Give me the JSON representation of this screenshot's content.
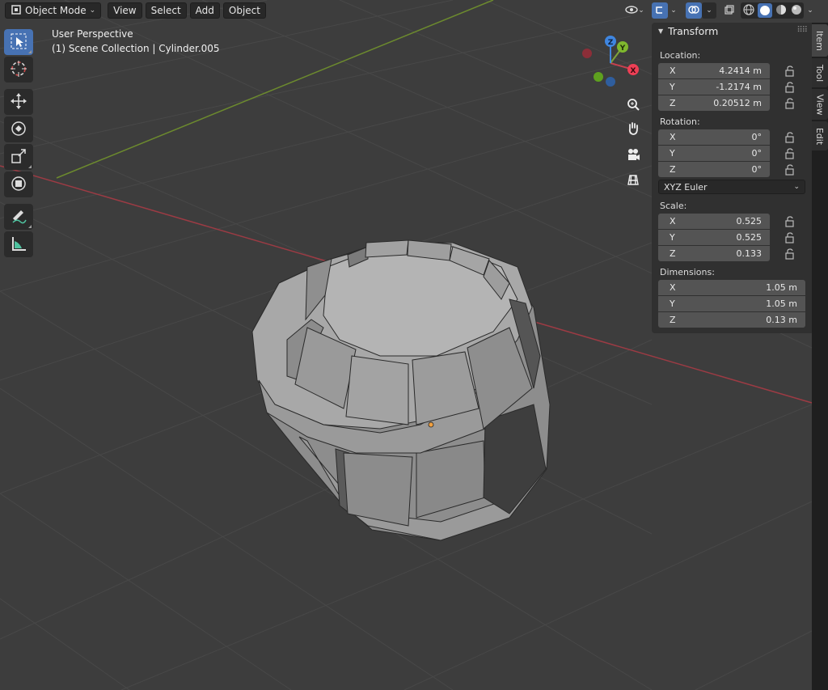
{
  "header": {
    "mode_label": "Object Mode",
    "menus": [
      "View",
      "Select",
      "Add",
      "Object"
    ]
  },
  "viewport": {
    "perspective_label": "User Perspective",
    "collection_label": "(1) Scene Collection | Cylinder.005"
  },
  "gizmo": {
    "x_label": "X",
    "y_label": "Y",
    "z_label": "Z"
  },
  "sidebar_tabs": [
    "Item",
    "Tool",
    "View",
    "Edit"
  ],
  "transform": {
    "title": "Transform",
    "location_label": "Location:",
    "location": [
      {
        "axis": "X",
        "value": "4.2414 m"
      },
      {
        "axis": "Y",
        "value": "-1.2174 m"
      },
      {
        "axis": "Z",
        "value": "0.20512 m"
      }
    ],
    "rotation_label": "Rotation:",
    "rotation": [
      {
        "axis": "X",
        "value": "0°"
      },
      {
        "axis": "Y",
        "value": "0°"
      },
      {
        "axis": "Z",
        "value": "0°"
      }
    ],
    "rotation_mode": "XYZ Euler",
    "scale_label": "Scale:",
    "scale": [
      {
        "axis": "X",
        "value": "0.525"
      },
      {
        "axis": "Y",
        "value": "0.525"
      },
      {
        "axis": "Z",
        "value": "0.133"
      }
    ],
    "dimensions_label": "Dimensions:",
    "dimensions": [
      {
        "axis": "X",
        "value": "1.05 m"
      },
      {
        "axis": "Y",
        "value": "1.05 m"
      },
      {
        "axis": "Z",
        "value": "0.13 m"
      }
    ]
  },
  "colors": {
    "viewport_bg": "#3d3d3d",
    "x_axis": "#c6414f",
    "y_axis": "#7fa23a",
    "z_axis": "#3f86e0",
    "active_tool": "#4772b3"
  },
  "icons": {
    "toolbar": [
      "select-box-icon",
      "cursor-icon",
      "move-icon",
      "rotate-icon",
      "scale-icon",
      "transform-icon",
      "annotate-icon",
      "measure-icon"
    ],
    "navigation": [
      "zoom-icon",
      "pan-hand-icon",
      "camera-icon",
      "grid-view-icon"
    ]
  }
}
